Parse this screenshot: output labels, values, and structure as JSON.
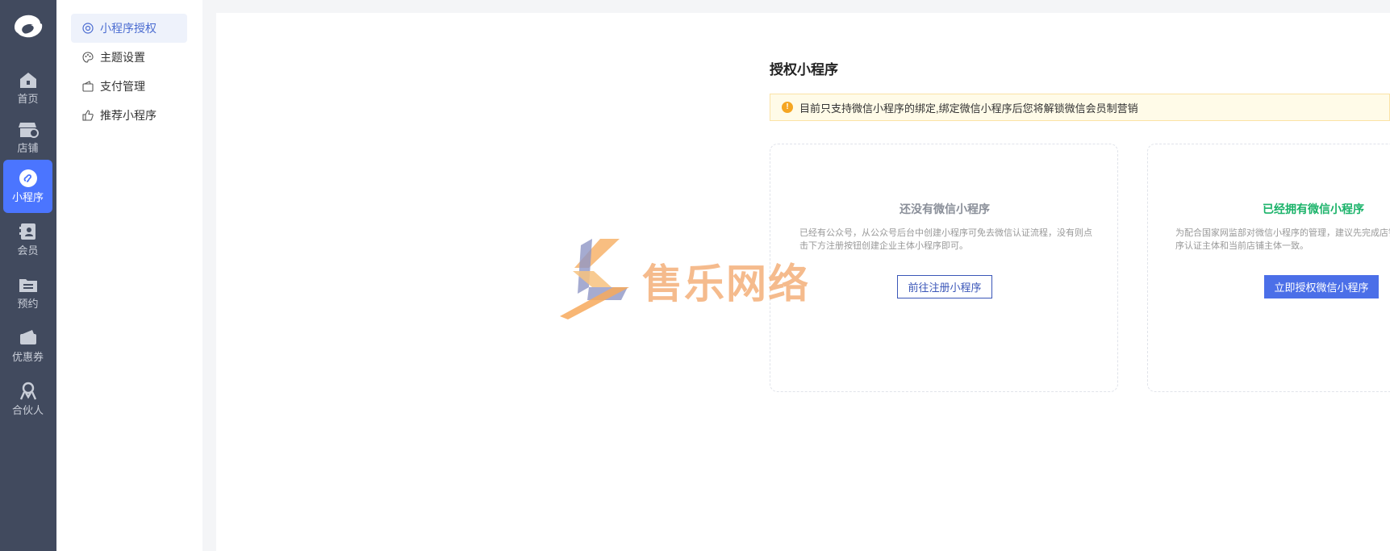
{
  "nav": {
    "items": [
      {
        "label": "首页",
        "icon": "home-icon"
      },
      {
        "label": "店铺",
        "icon": "shop-icon"
      },
      {
        "label": "小程序",
        "icon": "mini-program-icon"
      },
      {
        "label": "会员",
        "icon": "member-icon"
      },
      {
        "label": "预约",
        "icon": "appointment-icon"
      },
      {
        "label": "优惠券",
        "icon": "coupon-icon"
      },
      {
        "label": "合伙人",
        "icon": "partner-icon"
      }
    ],
    "active_index": 2,
    "accent": "#4b75ff",
    "background": "#414a5e"
  },
  "submenu": {
    "items": [
      {
        "label": "小程序授权",
        "icon": "auth-icon"
      },
      {
        "label": "主题设置",
        "icon": "palette-icon"
      },
      {
        "label": "支付管理",
        "icon": "wallet-icon"
      },
      {
        "label": "推荐小程序",
        "icon": "thumbs-up-icon"
      }
    ],
    "active_index": 0
  },
  "main": {
    "title": "授权小程序",
    "notice": "目前只支持微信小程序的绑定,绑定微信小程序后您将解锁微信会员制营销",
    "card_no": {
      "title": "还没有微信小程序",
      "desc": "已经有公众号，从公众号后台中创建小程序可免去微信认证流程，没有则点击下方注册按钮创建企业主体小程序即可。",
      "button": "前往注册小程序"
    },
    "card_yes": {
      "title": "已经拥有微信小程序",
      "desc_line1": "为配合国家网监部对微信小程序的管理，建议先完成店铺",
      "desc_line2": "序认证主体和当前店铺主体一致。",
      "button": "立即授权微信小程序"
    }
  },
  "watermark": {
    "text": "售乐网络"
  }
}
